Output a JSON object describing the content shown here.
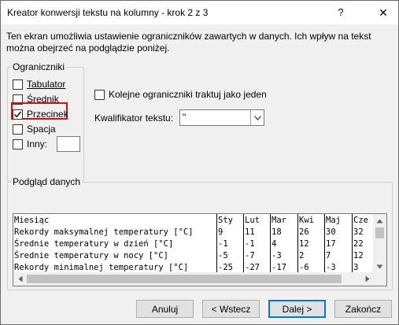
{
  "window": {
    "title": "Kreator konwersji tekstu na kolumny - krok 2 z 3",
    "help_label": "?",
    "close_label": "✕"
  },
  "description": "Ten ekran umożliwia ustawienie ograniczników zawartych w danych. Ich wpływ na tekst można obejrzeć na podglądzie poniżej.",
  "delimiters": {
    "legend": "Ograniczniki",
    "items": [
      {
        "label": "Tabulator",
        "checked": false
      },
      {
        "label": "Średnik",
        "checked": false
      },
      {
        "label": "Przecinek",
        "checked": true
      },
      {
        "label": "Spacja",
        "checked": false
      },
      {
        "label": "Inny:",
        "checked": false,
        "value": ""
      }
    ]
  },
  "consecutive": {
    "label": "Kolejne ograniczniki traktuj jako jeden",
    "checked": false
  },
  "qualifier": {
    "label": "Kwalifikator tekstu:",
    "value": "\""
  },
  "preview": {
    "legend": "Podgląd danych",
    "rows": [
      [
        "Miesiąc",
        "Sty",
        "Lut",
        "Mar",
        "Kwi",
        "Maj",
        "Cze"
      ],
      [
        "Rekordy maksymalnej temperatury [°C]",
        "9",
        "11",
        "18",
        "26",
        "30",
        "32"
      ],
      [
        "Średnie temperatury w dzień [°C]",
        "-1",
        "-1",
        "4",
        "12",
        "17",
        "22"
      ],
      [
        "Średnie temperatury w nocy [°C]",
        "-5",
        "-7",
        "-3",
        "2",
        "7",
        "12"
      ],
      [
        "Rekordy minimalnej temperatury [°C]",
        "-25",
        "-27",
        "-17",
        "-6",
        "-3",
        "3"
      ]
    ]
  },
  "buttons": {
    "cancel": "Anuluj",
    "back": "< Wstecz",
    "next": "Dalej >",
    "finish": "Zakończ"
  }
}
